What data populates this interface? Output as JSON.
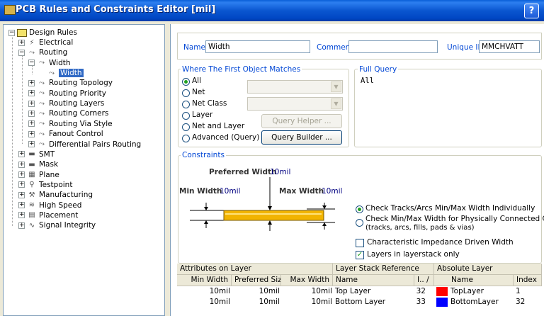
{
  "window": {
    "title": "PCB Rules and Constraints Editor [mil]",
    "help_label": "?"
  },
  "tree": {
    "root": "Design Rules",
    "items": [
      {
        "label": "Electrical",
        "expander": "+",
        "icon": "electrical-icon"
      },
      {
        "label": "Routing",
        "expander": "−",
        "icon": "routing-icon"
      },
      {
        "label": "Width",
        "expander": "−",
        "icon": "width-icon"
      },
      {
        "label": "Width",
        "expander": "",
        "icon": "width-rule-icon",
        "selected": true
      },
      {
        "label": "Routing Topology",
        "expander": "+",
        "icon": "topology-icon"
      },
      {
        "label": "Routing Priority",
        "expander": "+",
        "icon": "priority-icon"
      },
      {
        "label": "Routing Layers",
        "expander": "+",
        "icon": "layers-icon"
      },
      {
        "label": "Routing Corners",
        "expander": "+",
        "icon": "corners-icon"
      },
      {
        "label": "Routing Via Style",
        "expander": "+",
        "icon": "via-icon"
      },
      {
        "label": "Fanout Control",
        "expander": "+",
        "icon": "fanout-icon"
      },
      {
        "label": "Differential Pairs Routing",
        "expander": "+",
        "icon": "diffpair-icon"
      },
      {
        "label": "SMT",
        "expander": "+",
        "icon": "smt-icon"
      },
      {
        "label": "Mask",
        "expander": "+",
        "icon": "mask-icon"
      },
      {
        "label": "Plane",
        "expander": "+",
        "icon": "plane-icon"
      },
      {
        "label": "Testpoint",
        "expander": "+",
        "icon": "testpoint-icon"
      },
      {
        "label": "Manufacturing",
        "expander": "+",
        "icon": "manufacturing-icon"
      },
      {
        "label": "High Speed",
        "expander": "+",
        "icon": "highspeed-icon"
      },
      {
        "label": "Placement",
        "expander": "+",
        "icon": "placement-icon"
      },
      {
        "label": "Signal Integrity",
        "expander": "+",
        "icon": "signal-icon"
      }
    ]
  },
  "rule": {
    "name_label": "Name",
    "name_value": "Width",
    "comment_label": "Comment",
    "comment_value": "",
    "uid_label": "Unique ID",
    "uid_value": "MMCHVATT"
  },
  "matches": {
    "title": "Where The First Object Matches",
    "options": [
      "All",
      "Net",
      "Net Class",
      "Layer",
      "Net and Layer",
      "Advanced (Query)"
    ],
    "selected": "All",
    "query_helper": "Query Helper ...",
    "query_builder": "Query Builder ..."
  },
  "full_query": {
    "title": "Full Query",
    "text": "All"
  },
  "constraints": {
    "title": "Constraints",
    "preferred_label": "Preferred Width",
    "preferred_value": "10mil",
    "min_label": "Min Width",
    "min_value": "10mil",
    "max_label": "Max Width",
    "max_value": "10mil",
    "opt_individual": "Check Tracks/Arcs Min/Max Width Individually",
    "opt_connected_1": "Check Min/Max Width for Physically Connected Copper",
    "opt_connected_2": "(tracks, arcs, fills, pads & vias)",
    "impedance_label": "Characteristic Impedance Driven Width",
    "impedance_checked": false,
    "layerstack_label": "Layers in layerstack only",
    "layerstack_checked": true,
    "track_color": "#f2b400"
  },
  "table": {
    "group_headers": [
      "Attributes on Layer",
      "Layer Stack Reference",
      "Absolute Layer"
    ],
    "columns": [
      "Min Width",
      "Preferred Size",
      "Max Width",
      "Name",
      "I.. /",
      "Name",
      "Index"
    ],
    "rows": [
      {
        "min": "10mil",
        "pref": "10mil",
        "max": "10mil",
        "name": "Top Layer",
        "i": "32",
        "color": "#ff0000",
        "abs_name": "TopLayer",
        "index": "1"
      },
      {
        "min": "10mil",
        "pref": "10mil",
        "max": "10mil",
        "name": "Bottom Layer",
        "i": "33",
        "color": "#0000ff",
        "abs_name": "BottomLayer",
        "index": "32"
      }
    ]
  }
}
